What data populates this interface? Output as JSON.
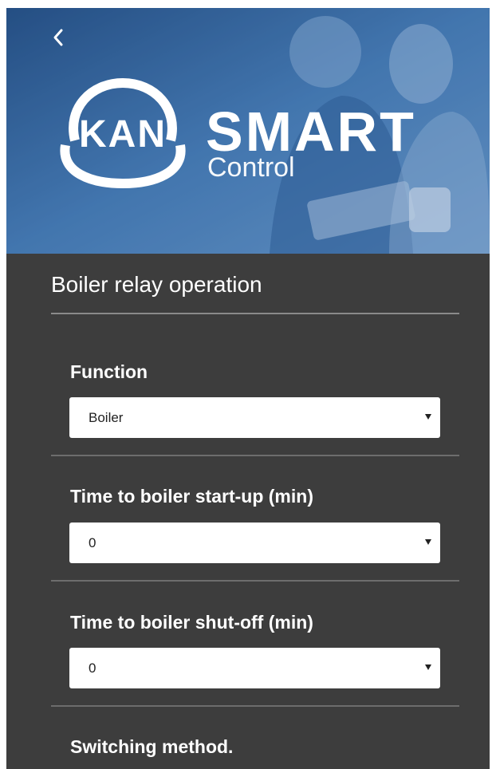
{
  "header": {
    "back_icon": "chevron-left-icon",
    "logo_text": "KAN",
    "brand_title": "SMART",
    "brand_subtitle": "Control"
  },
  "page": {
    "section_title": "Boiler relay operation"
  },
  "settings": [
    {
      "label": "Function",
      "value": "Boiler"
    },
    {
      "label": "Time to boiler start-up (min)",
      "value": "0"
    },
    {
      "label": "Time to boiler shut-off (min)",
      "value": "0"
    },
    {
      "label": "Switching method.",
      "value": ""
    }
  ],
  "colors": {
    "panel_background": "#3d3d3d",
    "hero_blue": "#3d73ad",
    "select_background": "#ffffff",
    "text_light": "#ffffff"
  }
}
